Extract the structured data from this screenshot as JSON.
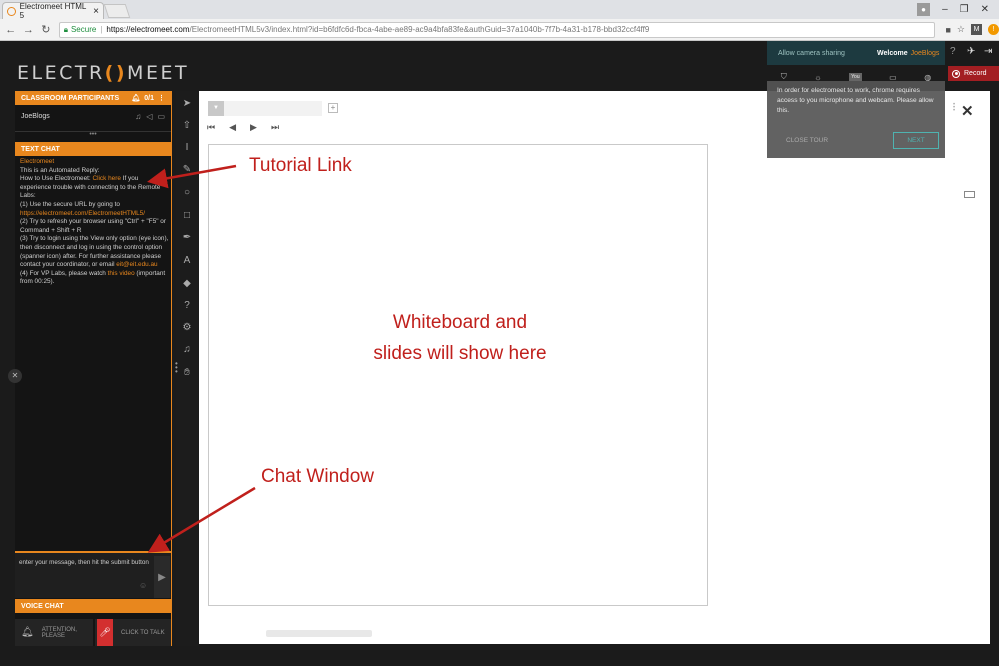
{
  "browser": {
    "tab_title": "Electromeet HTML 5",
    "url_secure_label": "Secure",
    "url_host": "https://electromeet.com",
    "url_path": "/ElectromeetHTML5v3/index.html?id=b6fdfc6d-fbca-4abe-ae89-ac9a4bfa83fe&authGuid=37a1040b-7f7b-4a31-b178-bbd32ccf4ff9"
  },
  "app": {
    "logo_left": "ELECTR",
    "logo_o": "()",
    "logo_right": "MEET"
  },
  "participants": {
    "header": "CLASSROOM PARTICIPANTS",
    "count": "0/1",
    "name": "JoeBlogs"
  },
  "text_chat": {
    "header": "TEXT CHAT",
    "sender": "Electromeet",
    "lines": {
      "l1": "This is an Automated Reply:",
      "l2a": "How to Use Electromeet: ",
      "l2link": "Click here",
      "l2b": " If you experience trouble with connecting to the Remote Labs:",
      "l3": "(1) Use the secure URL by going to",
      "l3link": "https://electromeet.com/ElectromeetHTML5/",
      "l4": "(2) Try to refresh your browser using \"Ctrl\" + \"F5\" or Command + Shift + R",
      "l5a": "(3) Try to login using the View only option (eye icon), then disconnect and log in using the control option (spanner icon) after. For further assistance please contact your coordinator, or email ",
      "l5link": "eit@eit.edu.au",
      "l6a": "(4) For VP Labs, please watch ",
      "l6link": "this video",
      "l6b": " (important from 00:25)."
    },
    "input_placeholder": "enter your message, then hit the submit button"
  },
  "voice_chat": {
    "header": "VOICE CHAT",
    "attention": "ATTENTION, PLEASE",
    "talk": "CLICK TO TALK"
  },
  "topbar": {
    "allow_camera": "Allow camera sharing",
    "welcome": "Welcome",
    "user": "JoeBlogs",
    "record": "Record"
  },
  "tour": {
    "text": "In order for electromeet to work, chrome requires access to you microphone and webcam. Please allow this.",
    "close": "CLOSE TOUR",
    "next": "NEXT"
  },
  "whiteboard": {
    "note_line1": "Whiteboard and",
    "note_line2": "slides will show here"
  },
  "annotations": {
    "tutorial_link": "Tutorial Link",
    "chat_window": "Chat Window"
  },
  "colors": {
    "accent": "#e8871e",
    "annotation": "#c0201c",
    "record": "#a31e22"
  }
}
